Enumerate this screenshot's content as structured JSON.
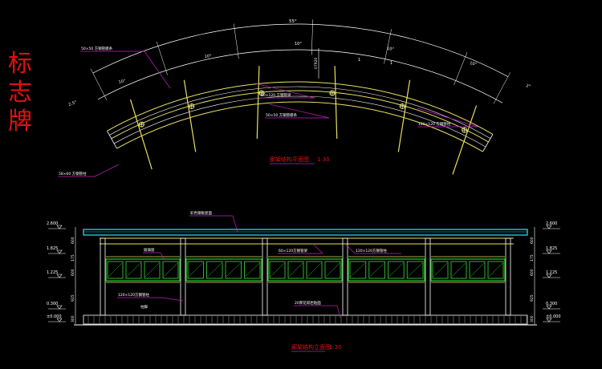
{
  "side_title": {
    "chars": [
      "标",
      "志",
      "牌"
    ]
  },
  "plan": {
    "arc_total": "55°",
    "seg_angles": [
      "10°",
      "10°",
      "10°",
      "10°",
      "10°",
      "2°",
      "2.5°"
    ],
    "dim_v": "07920",
    "tick_marks": [
      "1",
      "1"
    ],
    "callouts": {
      "purlin_top": "50×50 方钢管檩条",
      "beam_mid": "60×120 方钢管梁",
      "purlin_mid": "50×50 方钢管檩条",
      "beam_right": "120×120 方钢管柱",
      "bottom_left": "58×60 方钢管柱"
    },
    "title": "廊架结构平面图",
    "scale": "1:30"
  },
  "elev": {
    "levels_left": [
      "2.600",
      "1.825",
      "1.225",
      "0.300",
      "±0.000"
    ],
    "levels_right": [
      "2.600",
      "1.825",
      "1.225",
      "0.300",
      "±0.000"
    ],
    "dims_left": [
      "600",
      "175",
      "600",
      "925",
      "300"
    ],
    "dims_right": [
      "600",
      "175",
      "600",
      "925",
      "300"
    ],
    "callouts": {
      "roof": "彩色钢板屋面",
      "panel": "玻璃窗",
      "beam_a": "60×120方钢管梁",
      "beam_b": "120×120方钢管柱",
      "post": "120×120方钢管柱",
      "post2": "柱脚",
      "base": "20厚花岗岩贴面"
    },
    "title": "廊架结构立面图",
    "scale": "1:30"
  },
  "colors": {
    "bg": "#000000",
    "white": "#ffffff",
    "yellow": "#e8e060",
    "cyan": "#30d0e8",
    "green": "#30c830",
    "magenta": "#c020c0",
    "red": "#e01010",
    "gray": "#a0a0a0"
  }
}
